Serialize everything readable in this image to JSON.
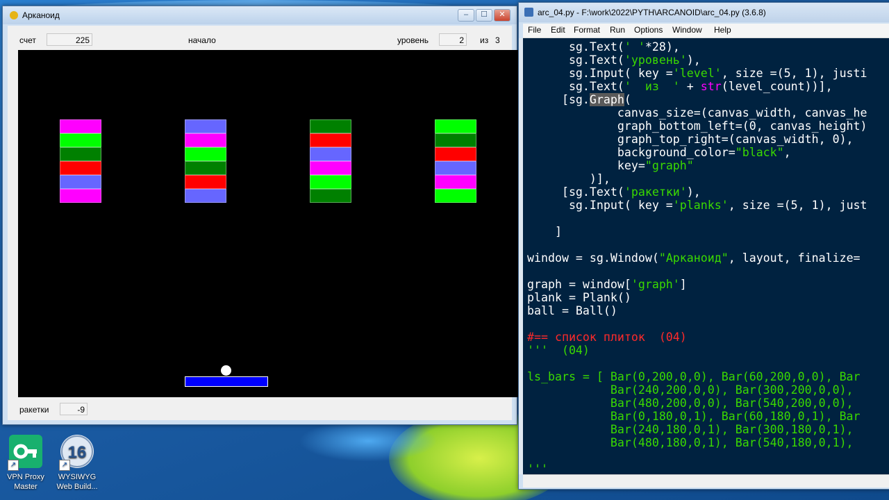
{
  "game_window": {
    "title": "Арканоид",
    "controls": {
      "minimize": "–",
      "maximize": "☐",
      "close": "✕"
    },
    "score_label": "счет",
    "score_value": "225",
    "start_label": "начало",
    "level_label": "уровень",
    "level_value": "2",
    "level_of_label": "из",
    "level_count": "3",
    "planks_label": "ракетки",
    "planks_value": "-9",
    "canvas_background": "#000000",
    "paddle_color": "#0000ff",
    "ball_color": "#ffffff",
    "brick_columns": [
      [
        "#ff00ff",
        "#00ff00",
        "#008000",
        "#ff0000",
        "#6666ff",
        "#ff00ff"
      ],
      [
        "#6666ff",
        "#ff00ff",
        "#00ff00",
        "#008000",
        "#ff0000",
        "#6666ff"
      ],
      [
        "#008000",
        "#ff0000",
        "#6666ff",
        "#ff00ff",
        "#00ff00",
        "#008000"
      ],
      [
        "#00ff00",
        "#008000",
        "#ff0000",
        "#6666ff",
        "#ff00ff",
        "#00ff00"
      ]
    ]
  },
  "idle_window": {
    "title": "arc_04.py - F:\\work\\2022\\PYTH\\ARCANOID\\arc_04.py (3.6.8)",
    "menu": [
      "File",
      "Edit",
      "Format",
      "Run",
      "Options",
      "Window",
      "Help"
    ],
    "colors": {
      "editor_bg": "#002240",
      "string": "#3ad900",
      "keyword": "#ff9d00",
      "builtin": "#ff00ff",
      "comment": "#ff2a2a"
    }
  },
  "desktop_icons": [
    {
      "label": "VPN Proxy Master",
      "icon": "key-icon",
      "color": "#18b06e"
    },
    {
      "label": "WYSIWYG Web Build...",
      "icon": "globe-16-icon",
      "color": "#e8eef6"
    }
  ]
}
